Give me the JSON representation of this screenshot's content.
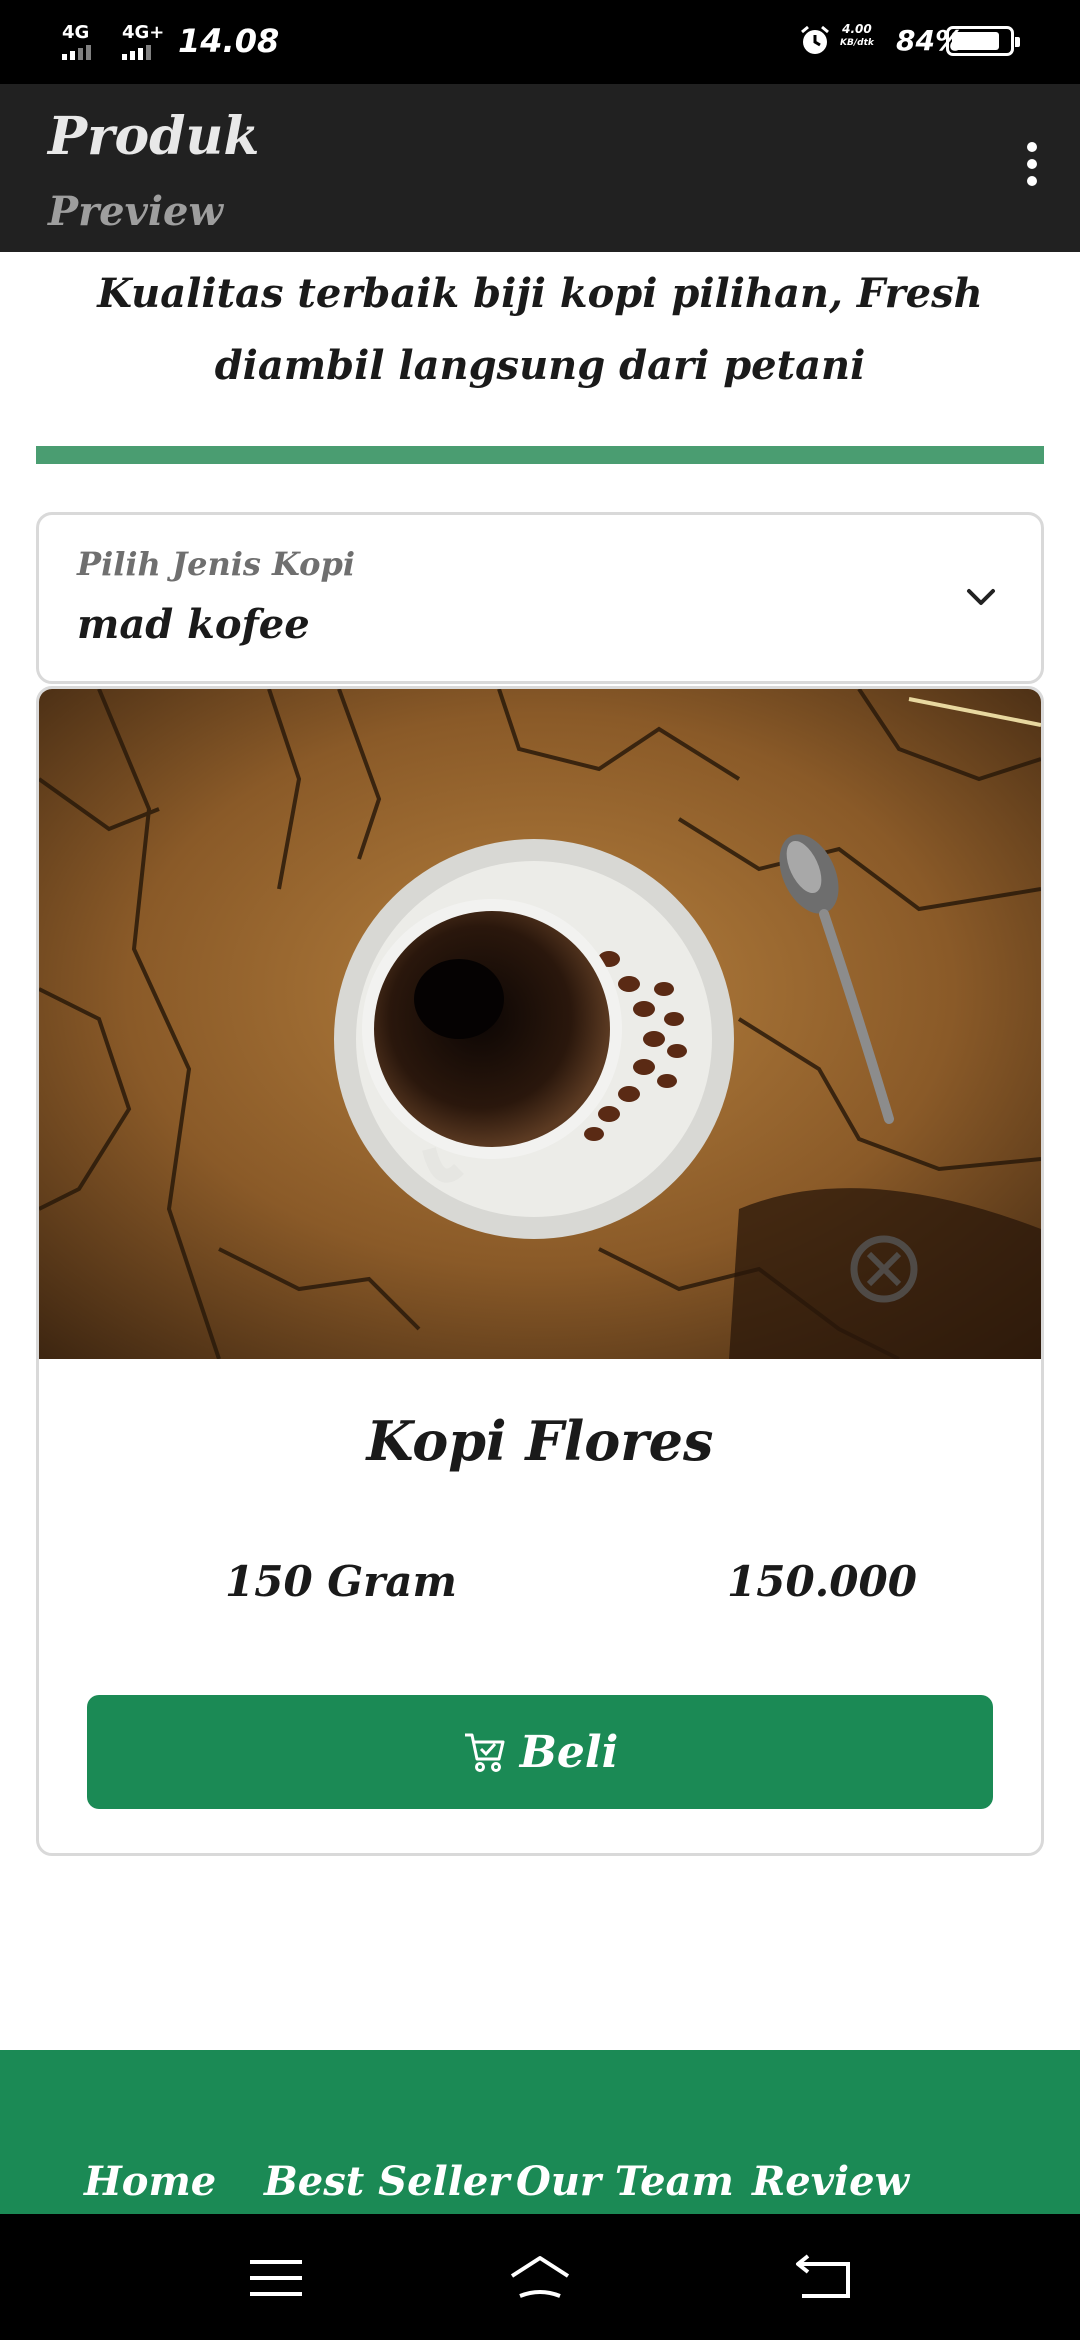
{
  "status_bar": {
    "network_1": "4G",
    "network_2": "4G+",
    "time": "14.08",
    "net_speed_value": "4.00",
    "net_speed_unit": "KB/dtk",
    "battery_percent": "84%",
    "battery_level": 0.84,
    "icons": [
      "signal-icon",
      "signal-icon",
      "alarm-icon",
      "battery-icon"
    ]
  },
  "app_bar": {
    "title": "Produk",
    "subtitle": "Preview",
    "menu_icon": "more-vert-icon"
  },
  "tagline": "Kualitas terbaik biji kopi pilihan, Fresh diambil langsung dari petani",
  "accent_color": "#4a9d71",
  "select": {
    "label": "Pilih Jenis Kopi",
    "value": "mad kofee",
    "icon": "chevron-down-icon"
  },
  "product": {
    "name": "Kopi Flores",
    "weight": "150 Gram",
    "price": "150.000",
    "buy_label": "Beli",
    "buy_icon": "cart-check-icon",
    "brand_color": "#1b8a55"
  },
  "footer": {
    "links": [
      "Home",
      "Best Seller",
      "Our Team",
      "Review"
    ]
  },
  "nav_bar": {
    "icons": [
      "menu-icon",
      "home-icon",
      "back-icon"
    ]
  }
}
